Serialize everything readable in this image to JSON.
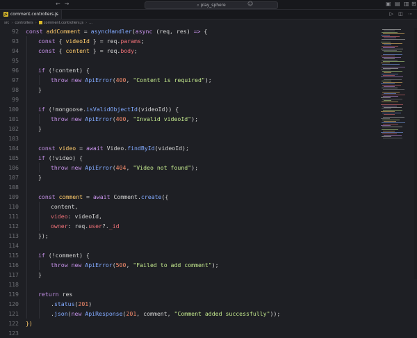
{
  "titlebar": {
    "search_text": "play_sphere",
    "nav_back": "←",
    "nav_forward": "→"
  },
  "tabs": [
    {
      "label": "comment.controllers.js",
      "badge": "JS",
      "close": "×"
    }
  ],
  "breadcrumb": [
    "src",
    "controllers",
    "comment.controllers.js",
    "..."
  ],
  "code": {
    "lines": [
      {
        "n": "92",
        "indent": 0,
        "t": [
          [
            "kw",
            "const "
          ],
          [
            "var",
            "addComment"
          ],
          [
            "pl",
            " = "
          ],
          [
            "fn",
            "asyncHandler"
          ],
          [
            "pl",
            "("
          ],
          [
            "kw",
            "async "
          ],
          [
            "pl",
            "(req, res) "
          ],
          [
            "kw",
            "=> "
          ],
          [
            "pl",
            "{"
          ]
        ]
      },
      {
        "n": "93",
        "indent": 1,
        "t": [
          [
            "kw",
            "const "
          ],
          [
            "pl",
            "{ "
          ],
          [
            "var",
            "videoId"
          ],
          [
            "pl",
            " } = req."
          ],
          [
            "prop",
            "params"
          ],
          [
            "pl",
            ";"
          ]
        ]
      },
      {
        "n": "94",
        "indent": 1,
        "t": [
          [
            "kw",
            "const "
          ],
          [
            "pl",
            "{ "
          ],
          [
            "var",
            "content"
          ],
          [
            "pl",
            " } = req."
          ],
          [
            "prop",
            "body"
          ],
          [
            "pl",
            ";"
          ]
        ]
      },
      {
        "n": "95",
        "indent": 0,
        "t": []
      },
      {
        "n": "96",
        "indent": 1,
        "t": [
          [
            "kw",
            "if "
          ],
          [
            "pl",
            "(!content) {"
          ]
        ]
      },
      {
        "n": "97",
        "indent": 2,
        "t": [
          [
            "kw",
            "throw new "
          ],
          [
            "fn",
            "ApiError"
          ],
          [
            "pl",
            "("
          ],
          [
            "num",
            "400"
          ],
          [
            "pl",
            ", "
          ],
          [
            "str",
            "\"Content is required\""
          ],
          [
            "pl",
            ");"
          ]
        ]
      },
      {
        "n": "98",
        "indent": 1,
        "t": [
          [
            "pl",
            "}"
          ]
        ]
      },
      {
        "n": "99",
        "indent": 0,
        "t": []
      },
      {
        "n": "100",
        "indent": 1,
        "t": [
          [
            "kw",
            "if "
          ],
          [
            "pl",
            "(!mongoose."
          ],
          [
            "fn",
            "isValidObjectId"
          ],
          [
            "pl",
            "(videoId)) {"
          ]
        ]
      },
      {
        "n": "101",
        "indent": 2,
        "t": [
          [
            "kw",
            "throw new "
          ],
          [
            "fn",
            "ApiError"
          ],
          [
            "pl",
            "("
          ],
          [
            "num",
            "400"
          ],
          [
            "pl",
            ", "
          ],
          [
            "str",
            "\"Invalid videoId\""
          ],
          [
            "pl",
            ");"
          ]
        ]
      },
      {
        "n": "102",
        "indent": 1,
        "t": [
          [
            "pl",
            "}"
          ]
        ]
      },
      {
        "n": "103",
        "indent": 0,
        "t": []
      },
      {
        "n": "104",
        "indent": 1,
        "t": [
          [
            "kw",
            "const "
          ],
          [
            "var",
            "video"
          ],
          [
            "pl",
            " = "
          ],
          [
            "kw",
            "await "
          ],
          [
            "pl",
            "Video."
          ],
          [
            "fn",
            "findById"
          ],
          [
            "pl",
            "(videoId);"
          ]
        ]
      },
      {
        "n": "105",
        "indent": 1,
        "t": [
          [
            "kw",
            "if "
          ],
          [
            "pl",
            "(!video) {"
          ]
        ]
      },
      {
        "n": "106",
        "indent": 2,
        "t": [
          [
            "kw",
            "throw new "
          ],
          [
            "fn",
            "ApiError"
          ],
          [
            "pl",
            "("
          ],
          [
            "num",
            "404"
          ],
          [
            "pl",
            ", "
          ],
          [
            "str",
            "\"Video not found\""
          ],
          [
            "pl",
            ");"
          ]
        ]
      },
      {
        "n": "107",
        "indent": 1,
        "t": [
          [
            "pl",
            "}"
          ]
        ]
      },
      {
        "n": "108",
        "indent": 0,
        "t": []
      },
      {
        "n": "109",
        "indent": 1,
        "t": [
          [
            "kw",
            "const "
          ],
          [
            "var",
            "comment"
          ],
          [
            "pl",
            " = "
          ],
          [
            "kw",
            "await "
          ],
          [
            "pl",
            "Comment."
          ],
          [
            "fn",
            "create"
          ],
          [
            "pl",
            "({"
          ]
        ]
      },
      {
        "n": "110",
        "indent": 2,
        "t": [
          [
            "pl",
            "content,"
          ]
        ]
      },
      {
        "n": "111",
        "indent": 2,
        "t": [
          [
            "prop",
            "video"
          ],
          [
            "pl",
            ": videoId,"
          ]
        ]
      },
      {
        "n": "112",
        "indent": 2,
        "t": [
          [
            "prop",
            "owner"
          ],
          [
            "pl",
            ": req."
          ],
          [
            "prop",
            "user"
          ],
          [
            "pl",
            "?."
          ],
          [
            "prop",
            "_id"
          ]
        ]
      },
      {
        "n": "113",
        "indent": 1,
        "t": [
          [
            "pl",
            "});"
          ]
        ]
      },
      {
        "n": "114",
        "indent": 0,
        "t": []
      },
      {
        "n": "115",
        "indent": 1,
        "t": [
          [
            "kw",
            "if "
          ],
          [
            "pl",
            "(!comment) {"
          ]
        ]
      },
      {
        "n": "116",
        "indent": 2,
        "t": [
          [
            "kw",
            "throw new "
          ],
          [
            "fn",
            "ApiError"
          ],
          [
            "pl",
            "("
          ],
          [
            "num",
            "500"
          ],
          [
            "pl",
            ", "
          ],
          [
            "str",
            "\"Failed to add comment\""
          ],
          [
            "pl",
            ");"
          ]
        ]
      },
      {
        "n": "117",
        "indent": 1,
        "t": [
          [
            "pl",
            "}"
          ]
        ]
      },
      {
        "n": "118",
        "indent": 0,
        "t": []
      },
      {
        "n": "119",
        "indent": 1,
        "t": [
          [
            "kw",
            "return "
          ],
          [
            "pl",
            "res"
          ]
        ]
      },
      {
        "n": "120",
        "indent": 2,
        "t": [
          [
            "pl",
            "."
          ],
          [
            "fn",
            "status"
          ],
          [
            "pl",
            "("
          ],
          [
            "num",
            "201"
          ],
          [
            "pl",
            ")"
          ]
        ]
      },
      {
        "n": "121",
        "indent": 2,
        "t": [
          [
            "pl",
            "."
          ],
          [
            "fn",
            "json"
          ],
          [
            "pl",
            "("
          ],
          [
            "kw",
            "new "
          ],
          [
            "fn",
            "ApiResponse"
          ],
          [
            "pl",
            "("
          ],
          [
            "num",
            "201"
          ],
          [
            "pl",
            ", comment, "
          ],
          [
            "str",
            "\"Comment added successfully\""
          ],
          [
            "pl",
            "));"
          ]
        ]
      },
      {
        "n": "122",
        "indent": 0,
        "t": [
          [
            "var",
            "})"
          ]
        ]
      },
      {
        "n": "123",
        "indent": 0,
        "t": []
      }
    ]
  },
  "colors": {
    "keyword": "#c792ea",
    "function": "#82aaff",
    "string": "#c3e88d",
    "number": "#f78c6c",
    "variable": "#ffcb6b",
    "property": "#f07178",
    "background": "#1e1f24"
  }
}
